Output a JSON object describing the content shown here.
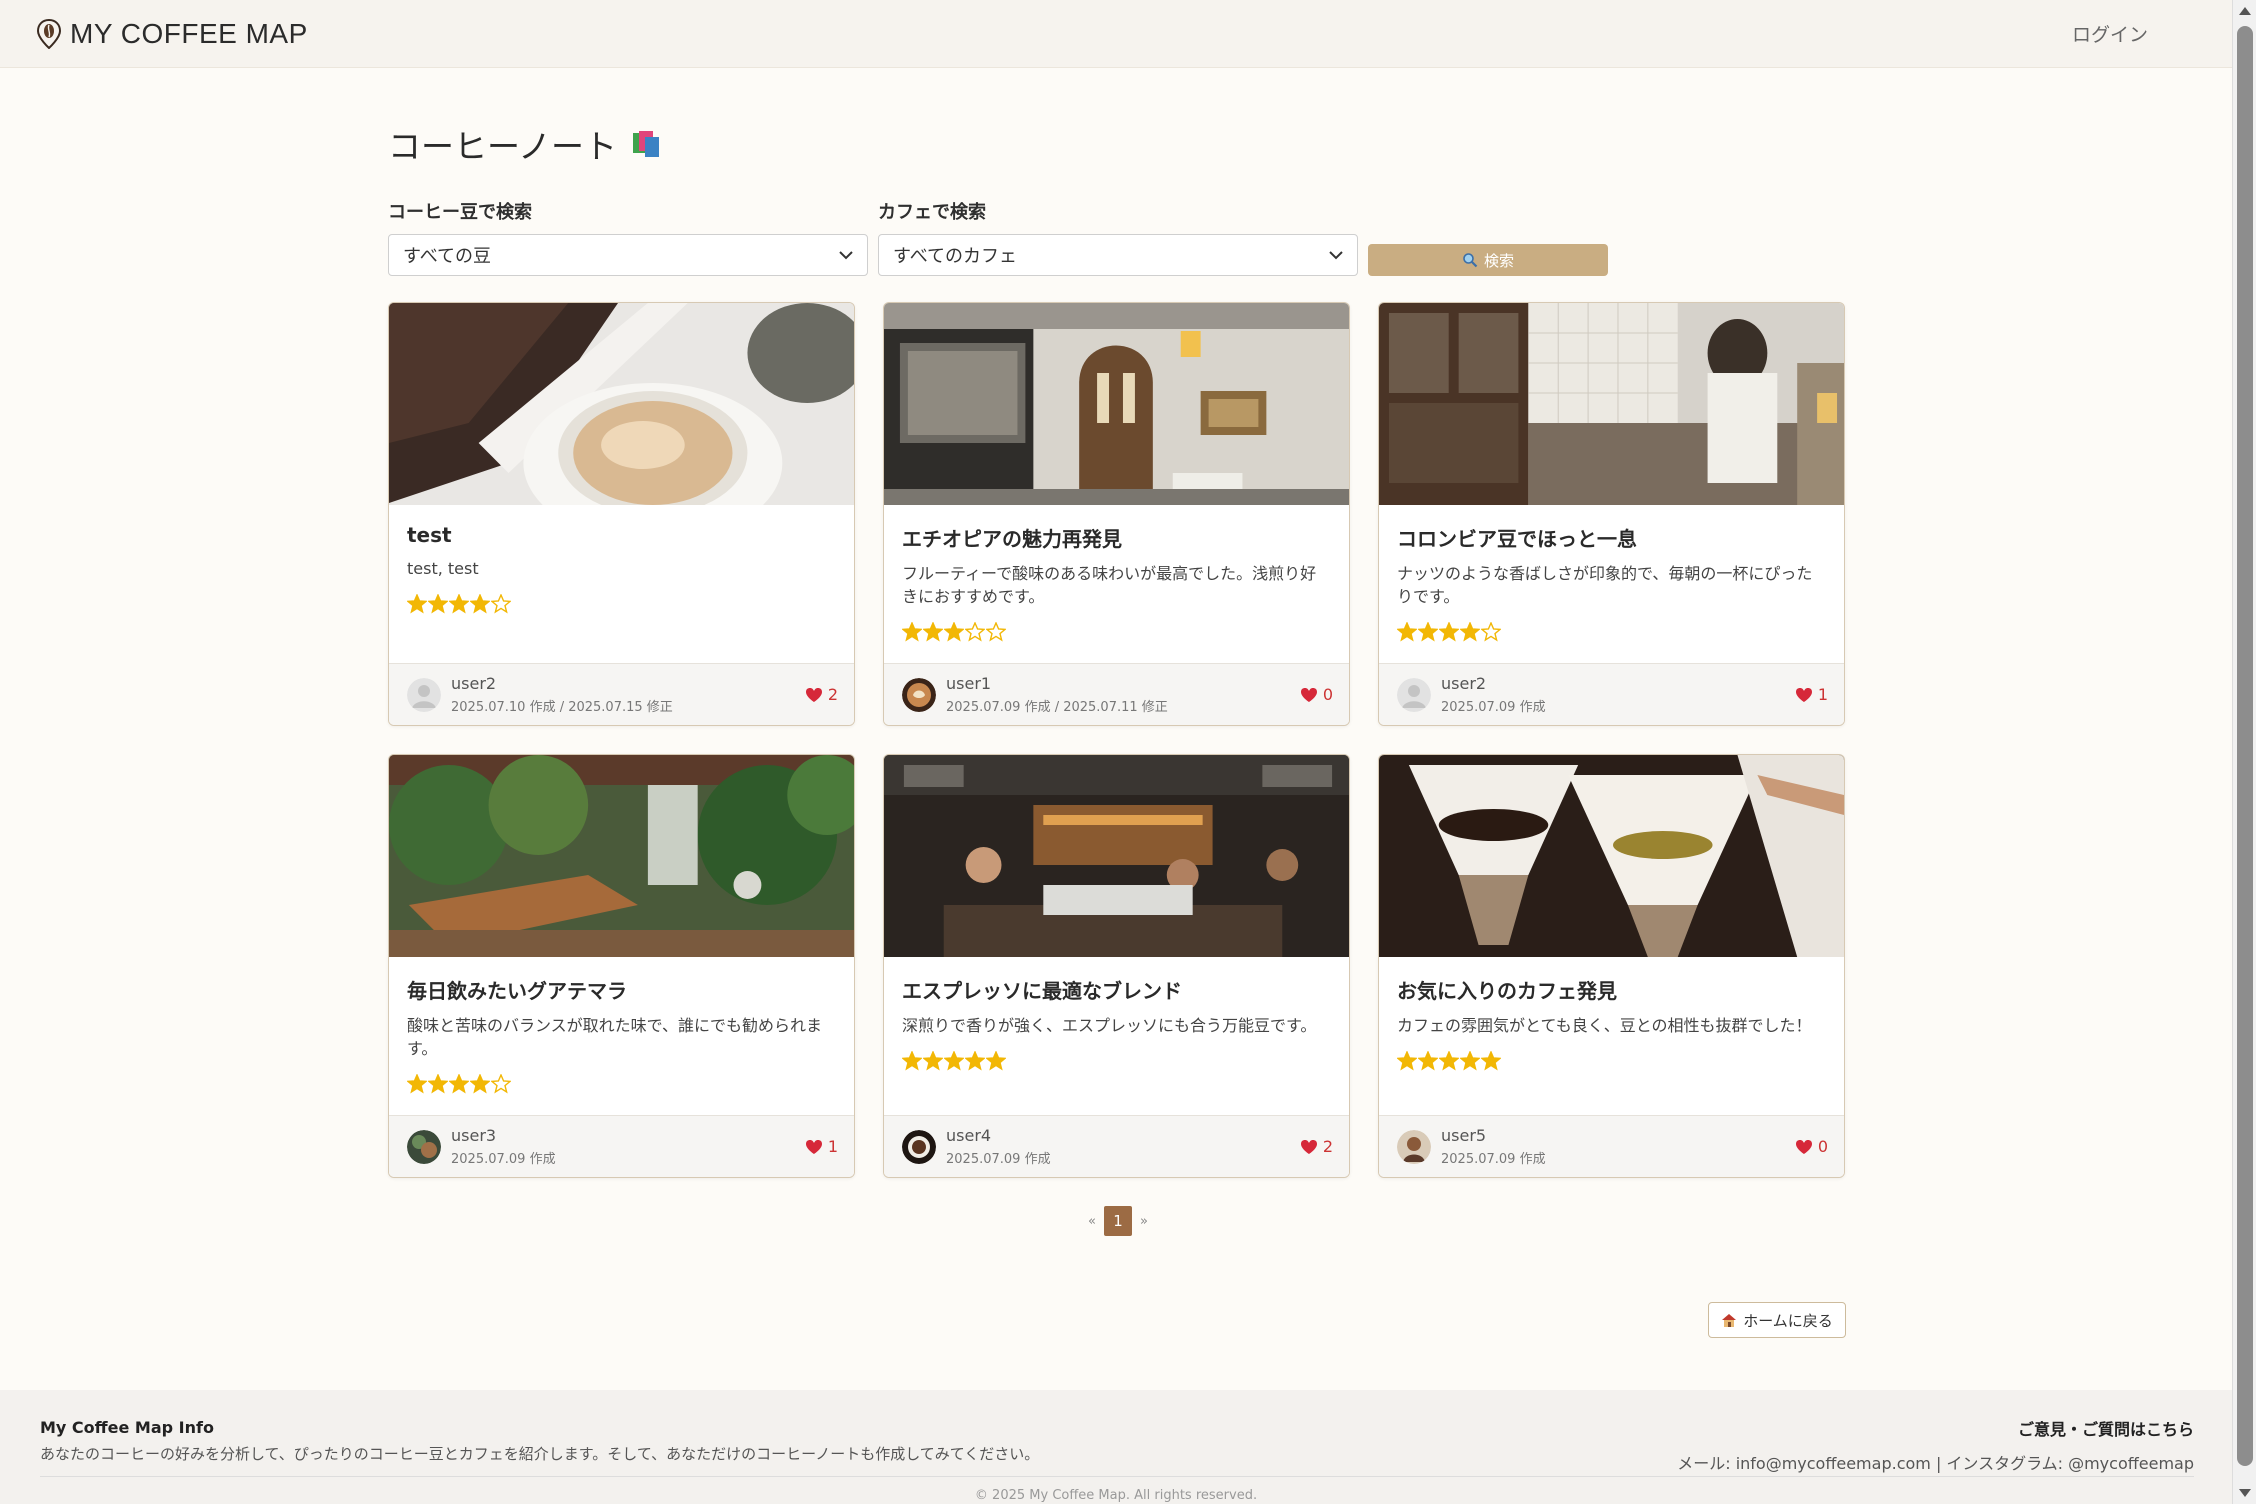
{
  "header": {
    "brand": "MY COFFEE MAP",
    "login": "ログイン"
  },
  "page": {
    "title": "コーヒーノート"
  },
  "filters": {
    "bean_label": "コーヒー豆で検索",
    "bean_value": "すべての豆",
    "cafe_label": "カフェで検索",
    "cafe_value": "すべてのカフェ",
    "search_button": "検索"
  },
  "colors": {
    "accent": "#c9ad82",
    "page_active": "#9c6b44",
    "star": "#f2b705",
    "heart": "#d62839"
  },
  "notes": [
    {
      "title": "test",
      "desc": "test, test",
      "rating": 4,
      "user": "user2",
      "date": "2025.07.10 作成 / 2025.07.15 修正",
      "likes": "2",
      "avatar": "default"
    },
    {
      "title": "エチオピアの魅力再発見",
      "desc": "フルーティーで酸味のある味わいが最高でした。浅煎り好きにおすすめです。",
      "rating": 3,
      "user": "user1",
      "date": "2025.07.09 作成 / 2025.07.11 修正",
      "likes": "0",
      "avatar": "latte"
    },
    {
      "title": "コロンビア豆でほっと一息",
      "desc": "ナッツのような香ばしさが印象的で、毎朝の一杯にぴったりです。",
      "rating": 4,
      "user": "user2",
      "date": "2025.07.09 作成",
      "likes": "1",
      "avatar": "default"
    },
    {
      "title": "毎日飲みたいグアテマラ",
      "desc": "酸味と苦味のバランスが取れた味で、誰にでも勧められます。",
      "rating": 4,
      "user": "user3",
      "date": "2025.07.09 作成",
      "likes": "1",
      "avatar": "photo"
    },
    {
      "title": "エスプレッソに最適なブレンド",
      "desc": "深煎りで香りが強く、エスプレッソにも合う万能豆です。",
      "rating": 5,
      "user": "user4",
      "date": "2025.07.09 作成",
      "likes": "2",
      "avatar": "dark"
    },
    {
      "title": "お気に入りのカフェ発見",
      "desc": "カフェの雰囲気がとても良く、豆との相性も抜群でした！",
      "rating": 5,
      "user": "user5",
      "date": "2025.07.09 作成",
      "likes": "0",
      "avatar": "portrait"
    }
  ],
  "pagination": {
    "prev": "«",
    "current": "1",
    "next": "»"
  },
  "home_button": "ホームに戻る",
  "footer": {
    "title": "My Coffee Map Info",
    "desc": "あなたのコーヒーの好みを分析して、ぴったりのコーヒー豆とカフェを紹介します。そして、あなただけのコーヒーノートも作成してみてください。",
    "contact_title": "ご意見・ご質問はこちら",
    "contact_line": "メール: info@mycoffeemap.com | インスタグラム: @mycoffeemap",
    "copyright": "© 2025 My Coffee Map. All rights reserved."
  }
}
